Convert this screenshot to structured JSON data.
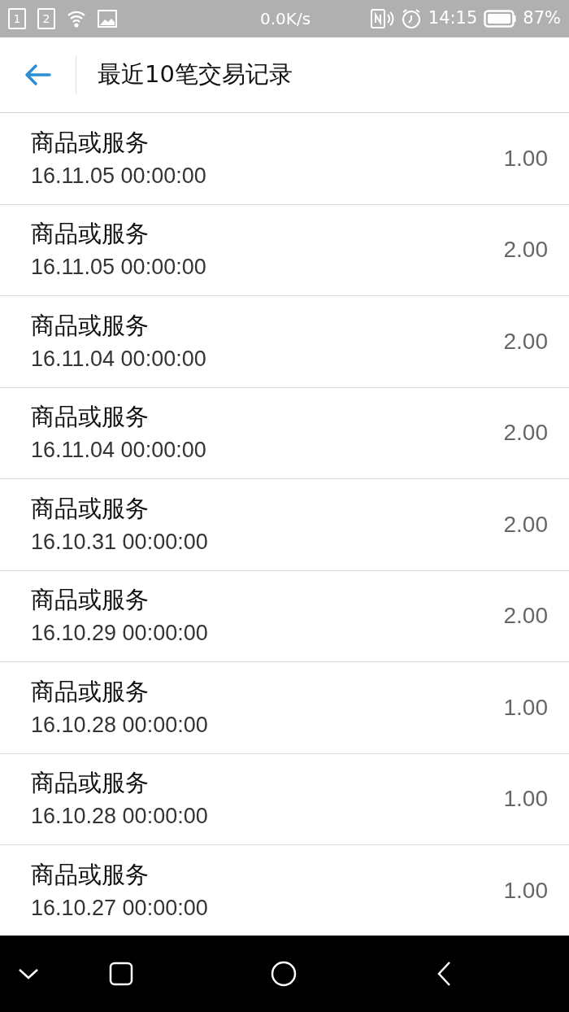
{
  "status_bar": {
    "sim_slots": [
      "1",
      "2"
    ],
    "speed": "0.0K/s",
    "time": "14:15",
    "battery": "87%"
  },
  "header": {
    "title": "最近10笔交易记录"
  },
  "transactions": [
    {
      "name": "商品或服务",
      "date": "16.11.05 00:00:00",
      "amount": "1.00"
    },
    {
      "name": "商品或服务",
      "date": "16.11.05 00:00:00",
      "amount": "2.00"
    },
    {
      "name": "商品或服务",
      "date": "16.11.04 00:00:00",
      "amount": "2.00"
    },
    {
      "name": "商品或服务",
      "date": "16.11.04 00:00:00",
      "amount": "2.00"
    },
    {
      "name": "商品或服务",
      "date": "16.10.31 00:00:00",
      "amount": "2.00"
    },
    {
      "name": "商品或服务",
      "date": "16.10.29 00:00:00",
      "amount": "2.00"
    },
    {
      "name": "商品或服务",
      "date": "16.10.28 00:00:00",
      "amount": "1.00"
    },
    {
      "name": "商品或服务",
      "date": "16.10.28 00:00:00",
      "amount": "1.00"
    },
    {
      "name": "商品或服务",
      "date": "16.10.27 00:00:00",
      "amount": "1.00"
    }
  ]
}
